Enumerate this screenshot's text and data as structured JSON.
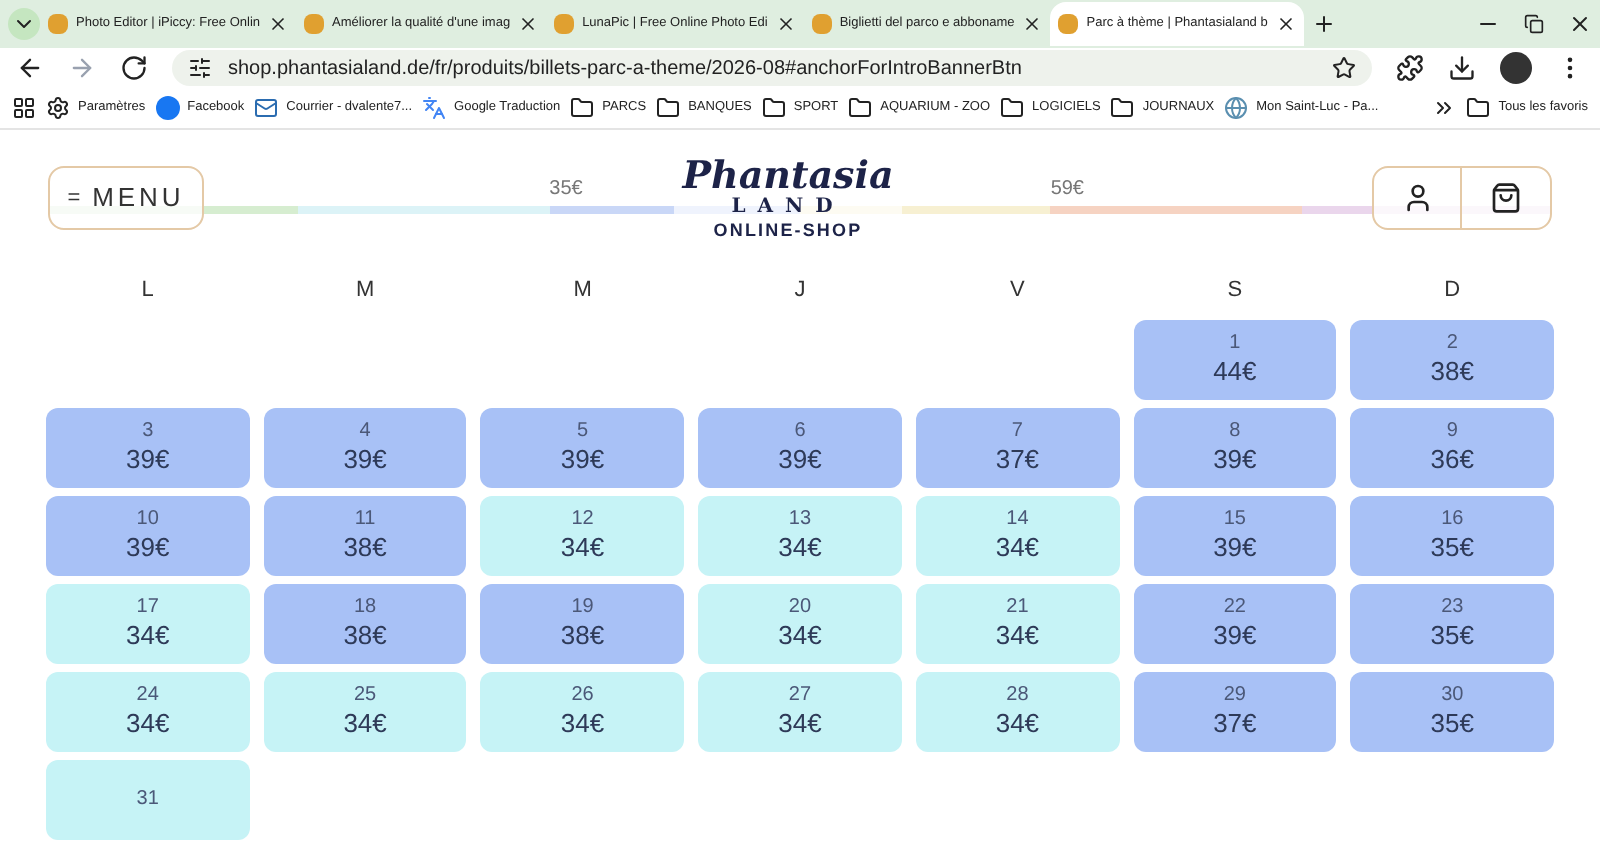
{
  "tabs": [
    {
      "title": "Photo Editor | iPiccy: Free Onlin",
      "selected": false
    },
    {
      "title": "Améliorer la qualité d'une imag",
      "selected": false
    },
    {
      "title": "LunaPic | Free Online Photo Edi",
      "selected": false
    },
    {
      "title": "Biglietti del parco e abboname",
      "selected": false
    },
    {
      "title": "Parc à thème | Phantasialand b",
      "selected": true
    }
  ],
  "address_bar": {
    "url": "shop.phantasialand.de/fr/produits/billets-parc-a-theme/2026-08#anchorForIntroBannerBtn"
  },
  "bookmarks": [
    {
      "kind": "gear",
      "label": "Paramètres"
    },
    {
      "kind": "facebook",
      "label": "Facebook"
    },
    {
      "kind": "mail",
      "label": "Courrier - dvalente7..."
    },
    {
      "kind": "translate",
      "label": "Google Traduction"
    },
    {
      "kind": "folder",
      "label": "PARCS"
    },
    {
      "kind": "folder",
      "label": "BANQUES"
    },
    {
      "kind": "folder",
      "label": "SPORT"
    },
    {
      "kind": "folder",
      "label": "AQUARIUM - ZOO"
    },
    {
      "kind": "folder",
      "label": "LOGICIELS"
    },
    {
      "kind": "folder",
      "label": "JOURNAUX"
    },
    {
      "kind": "site",
      "label": "Mon Saint-Luc - Pa..."
    }
  ],
  "all_bookmarks": "Tous les favoris",
  "site_header": {
    "menu": "MENU",
    "menu_glyph": "=",
    "logo": {
      "name": "Phantasia",
      "sub": "LAND",
      "tagline": "ONLINE-SHOP"
    },
    "price_bar": [
      {
        "color": "#d6edd0"
      },
      {
        "color": "#dcf3f7"
      },
      {
        "color": "#c9d7f7",
        "label": "35€"
      },
      {
        "color": "#f7f0d2"
      },
      {
        "color": "#f6d3c2",
        "label": "59€"
      },
      {
        "color": "#ead6ec"
      }
    ]
  },
  "weekdays": [
    "L",
    "M",
    "M",
    "J",
    "V",
    "S",
    "D"
  ],
  "days": [
    {
      "day": "1",
      "price": "44€",
      "color": "#a8c1f6"
    },
    {
      "day": "2",
      "price": "38€",
      "color": "#a8c1f6"
    },
    {
      "day": "3",
      "price": "39€",
      "color": "#a8c1f6"
    },
    {
      "day": "4",
      "price": "39€",
      "color": "#a8c1f6"
    },
    {
      "day": "5",
      "price": "39€",
      "color": "#a8c1f6"
    },
    {
      "day": "6",
      "price": "39€",
      "color": "#a8c1f6"
    },
    {
      "day": "7",
      "price": "37€",
      "color": "#a8c1f6"
    },
    {
      "day": "8",
      "price": "39€",
      "color": "#a8c1f6"
    },
    {
      "day": "9",
      "price": "36€",
      "color": "#a8c1f6"
    },
    {
      "day": "10",
      "price": "39€",
      "color": "#a8c1f6"
    },
    {
      "day": "11",
      "price": "38€",
      "color": "#a8c1f6"
    },
    {
      "day": "12",
      "price": "34€",
      "color": "#c6f3f6"
    },
    {
      "day": "13",
      "price": "34€",
      "color": "#c6f3f6"
    },
    {
      "day": "14",
      "price": "34€",
      "color": "#c6f3f6"
    },
    {
      "day": "15",
      "price": "39€",
      "color": "#a8c1f6"
    },
    {
      "day": "16",
      "price": "35€",
      "color": "#a8c1f6"
    },
    {
      "day": "17",
      "price": "34€",
      "color": "#c6f3f6"
    },
    {
      "day": "18",
      "price": "38€",
      "color": "#a8c1f6"
    },
    {
      "day": "19",
      "price": "38€",
      "color": "#a8c1f6"
    },
    {
      "day": "20",
      "price": "34€",
      "color": "#c6f3f6"
    },
    {
      "day": "21",
      "price": "34€",
      "color": "#c6f3f6"
    },
    {
      "day": "22",
      "price": "39€",
      "color": "#a8c1f6"
    },
    {
      "day": "23",
      "price": "35€",
      "color": "#a8c1f6"
    },
    {
      "day": "24",
      "price": "34€",
      "color": "#c6f3f6"
    },
    {
      "day": "25",
      "price": "34€",
      "color": "#c6f3f6"
    },
    {
      "day": "26",
      "price": "34€",
      "color": "#c6f3f6"
    },
    {
      "day": "27",
      "price": "34€",
      "color": "#c6f3f6"
    },
    {
      "day": "28",
      "price": "34€",
      "color": "#c6f3f6"
    },
    {
      "day": "29",
      "price": "37€",
      "color": "#a8c1f6"
    },
    {
      "day": "30",
      "price": "35€",
      "color": "#a8c1f6"
    },
    {
      "day": "31",
      "color": "#c6f3f6"
    }
  ]
}
